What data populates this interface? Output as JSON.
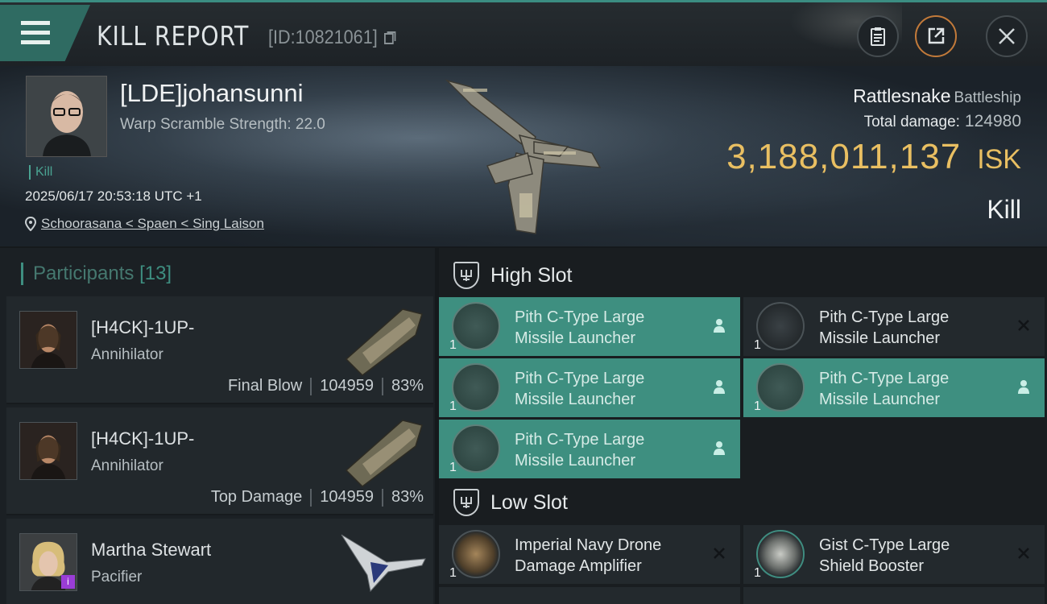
{
  "header": {
    "title": "KILL REPORT",
    "report_id": "[ID:10821061]"
  },
  "victim": {
    "name": "[LDE]johansunni",
    "warp_scramble": "Warp Scramble Strength: 22.0",
    "kill_tag": "Kill",
    "datetime": "2025/06/17 20:53:18 UTC +1",
    "location": "Schoorasana < Spaen < Sing Laison",
    "ship": "Rattlesnake",
    "ship_class": "Battleship",
    "total_damage_label": "Total damage:",
    "total_damage": "124980",
    "isk_value": "3,188,011,137",
    "isk_unit": "ISK",
    "result": "Kill"
  },
  "participants": {
    "title": "Participants",
    "count": "[13]",
    "rows": [
      {
        "name": "[H4CK]-1UP-",
        "ship": "Annihilator",
        "role": "Final Blow",
        "damage": "104959",
        "pct": "83%"
      },
      {
        "name": "[H4CK]-1UP-",
        "ship": "Annihilator",
        "role": "Top Damage",
        "damage": "104959",
        "pct": "83%"
      },
      {
        "name": "Martha Stewart",
        "ship": "Pacifier",
        "badge": "i"
      }
    ]
  },
  "fitting": {
    "high_slot_label": "High Slot",
    "low_slot_label": "Low Slot",
    "high": [
      {
        "line1": "Pith C-Type Large",
        "line2": "Missile Launcher",
        "qty": "1"
      },
      {
        "line1": "Pith C-Type Large",
        "line2": "Missile Launcher",
        "qty": "1"
      },
      {
        "line1": "Pith C-Type Large",
        "line2": "Missile Launcher",
        "qty": "1"
      },
      {
        "line1": "Pith C-Type Large",
        "line2": "Missile Launcher",
        "qty": "1"
      },
      {
        "line1": "Pith C-Type Large",
        "line2": "Missile Launcher",
        "qty": "1"
      }
    ],
    "low": [
      {
        "line1": "Imperial Navy Drone",
        "line2": "Damage Amplifier",
        "qty": "1"
      },
      {
        "line1": "Gist C-Type Large",
        "line2": "Shield Booster",
        "qty": "1"
      }
    ]
  },
  "colors": {
    "accent": "#3e8f80",
    "isk": "#e9bf62",
    "purple_badge": "#9a3dd6"
  },
  "icons": [
    "menu-icon",
    "copy-icon",
    "clipboard-icon",
    "share-icon",
    "close-icon",
    "location-pin-icon",
    "high-slot-icon",
    "low-slot-icon",
    "pilot-icon",
    "destroyed-icon"
  ]
}
